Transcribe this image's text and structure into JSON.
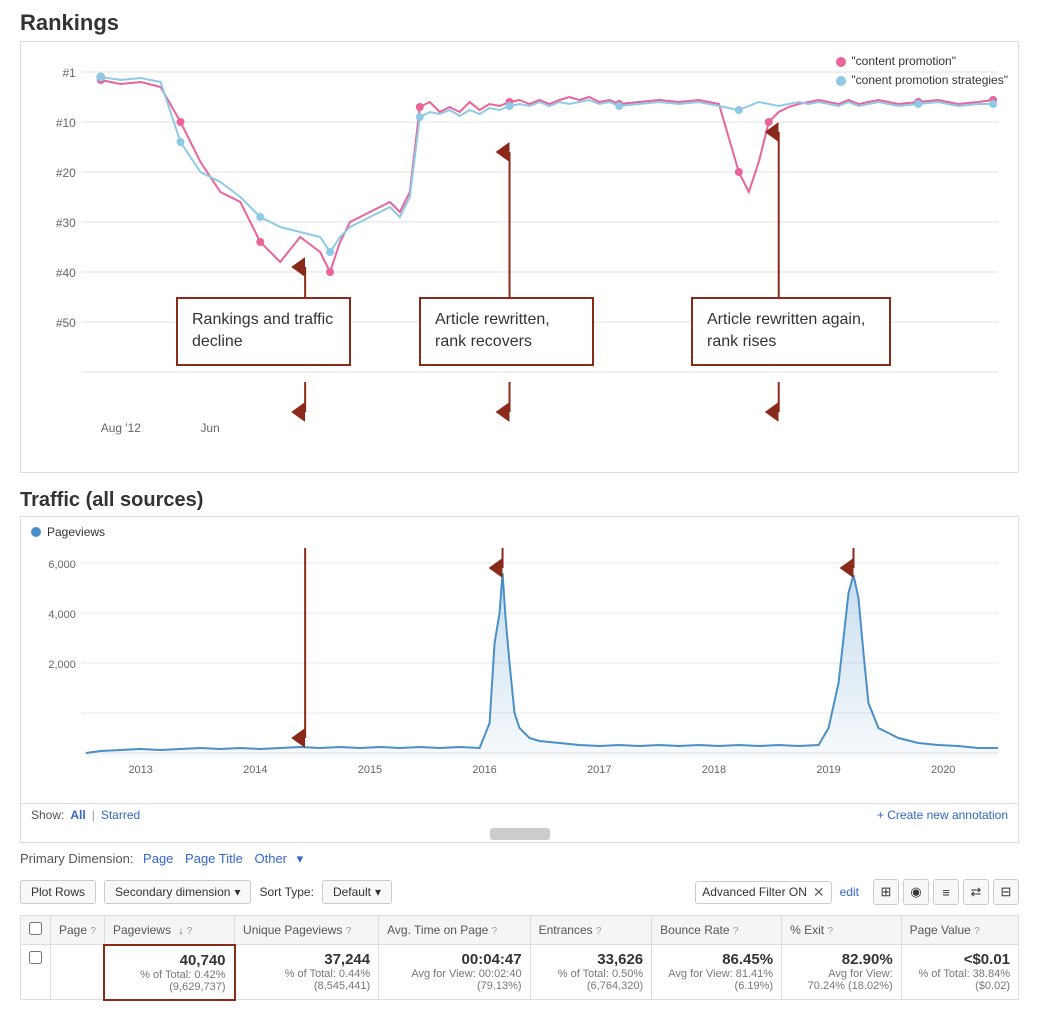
{
  "rankings": {
    "title": "Rankings",
    "legend": {
      "item1": "\"content promotion\"",
      "item2": "\"conent promotion strategies\""
    },
    "yAxis": [
      "#1",
      "#10",
      "#20",
      "#30",
      "#40",
      "#50"
    ],
    "xAxis": [
      "Aug '12",
      "Jun"
    ],
    "annotations": {
      "box1": {
        "label": "Rankings and traffic decline"
      },
      "box2": {
        "label": "Article rewritten, rank recovers"
      },
      "box3": {
        "label": "Article rewritten again, rank rises"
      }
    }
  },
  "traffic": {
    "title": "Traffic (all sources)",
    "legend": "Pageviews",
    "yAxis": [
      "6,000",
      "4,000",
      "2,000"
    ],
    "xAxis": [
      "2013",
      "2014",
      "2015",
      "2016",
      "2017",
      "2018",
      "2019",
      "2020"
    ],
    "showBar": {
      "showLabel": "Show:",
      "all": "All",
      "starred": "Starred",
      "createAnnotation": "+ Create new annotation"
    }
  },
  "primaryDimension": {
    "label": "Primary Dimension:",
    "page": "Page",
    "pageTitle": "Page Title",
    "other": "Other"
  },
  "toolbar": {
    "plotRows": "Plot Rows",
    "secondaryDimension": "Secondary dimension",
    "sortType": "Sort Type:",
    "default": "Default",
    "filter": "Advanced Filter ON",
    "edit": "edit"
  },
  "tableHeaders": {
    "page": "Page",
    "pageviews": "Pageviews",
    "uniquePageviews": "Unique Pageviews",
    "avgTimeOnPage": "Avg. Time on Page",
    "entrances": "Entrances",
    "bounceRate": "Bounce Rate",
    "pctExit": "% Exit",
    "pageValue": "Page Value"
  },
  "tableData": {
    "pageviews": {
      "main": "40,740",
      "sub": "% of Total: 0.42% (9,629,737)"
    },
    "uniquePageviews": {
      "main": "37,244",
      "sub": "% of Total: 0.44% (8,545,441)"
    },
    "avgTimeOnPage": {
      "main": "00:04:47",
      "sub": "Avg for View: 00:02:40 (79.13%)"
    },
    "entrances": {
      "main": "33,626",
      "sub": "% of Total: 0.50% (6,764,320)"
    },
    "bounceRate": {
      "main": "86.45%",
      "sub": "Avg for View: 81.41% (6.19%)"
    },
    "pctExit": {
      "main": "82.90%",
      "sub": "Avg for View: 70.24% (18.02%)"
    },
    "pageValue": {
      "main": "<$0.01",
      "sub": "% of Total: 38.84% ($0.02)"
    }
  }
}
